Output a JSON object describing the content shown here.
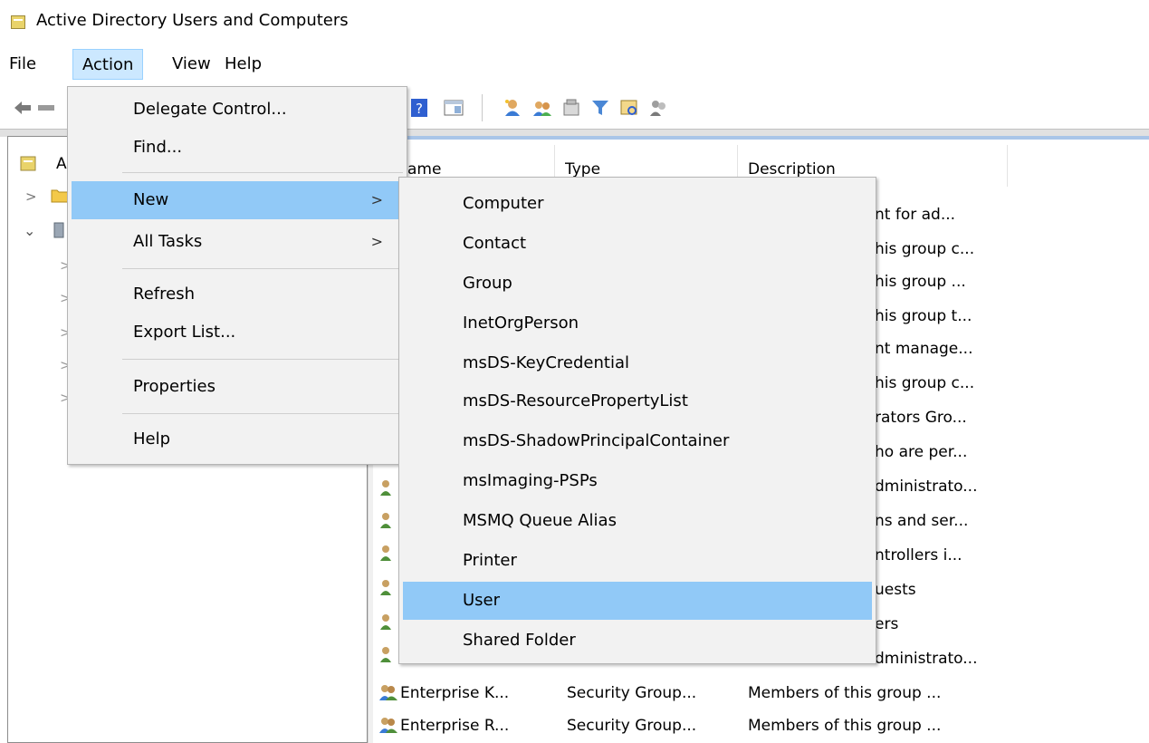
{
  "window": {
    "title": "Active Directory Users and Computers"
  },
  "menubar": {
    "items": [
      "File",
      "Action",
      "View",
      "Help"
    ],
    "active": "Action"
  },
  "toolbar": {
    "icons": [
      "back-arrow-icon",
      "forward-arrow-icon",
      "help-icon",
      "console-icon",
      "new-user-icon",
      "new-group-icon",
      "new-ou-icon",
      "filter-icon",
      "find-icon",
      "add-to-group-icon"
    ]
  },
  "tree": {
    "root_label_visible": "A",
    "chevrons": [
      ">",
      "⌄",
      ">",
      ">",
      ">",
      ">",
      ">"
    ]
  },
  "list": {
    "columns": [
      "Name",
      "Type",
      "Description"
    ],
    "column_heads_visible": [
      "ame",
      "Type",
      "Description"
    ],
    "visible_descriptions": [
      "nt for ad...",
      "his group c...",
      "his group ...",
      "his group t...",
      "nt manage...",
      "his group c...",
      "rators Gro...",
      "ho are per...",
      "dministrato...",
      "ns and ser...",
      "ntrollers i...",
      "uests",
      "ers",
      "dministrato..."
    ],
    "rows": [
      {
        "name": "Enterprise K...",
        "type": "Security Group...",
        "description": "Members of this group ..."
      },
      {
        "name": "Enterprise R...",
        "type": "Security Group...",
        "description": "Members of this group ..."
      }
    ]
  },
  "action_menu": {
    "items": [
      {
        "label": "Delegate Control...",
        "submenu": false
      },
      {
        "label": "Find...",
        "submenu": false
      },
      {
        "label": "New",
        "submenu": true
      },
      {
        "label": "All Tasks",
        "submenu": true
      },
      {
        "label": "Refresh",
        "submenu": false
      },
      {
        "label": "Export List...",
        "submenu": false
      },
      {
        "label": "Properties",
        "submenu": false
      },
      {
        "label": "Help",
        "submenu": false
      }
    ],
    "highlighted": "New",
    "arrow": ">"
  },
  "new_menu": {
    "items": [
      "Computer",
      "Contact",
      "Group",
      "InetOrgPerson",
      "msDS-KeyCredential",
      "msDS-ResourcePropertyList",
      "msDS-ShadowPrincipalContainer",
      "msImaging-PSPs",
      "MSMQ Queue Alias",
      "Printer",
      "User",
      "Shared Folder"
    ],
    "highlighted": "User"
  }
}
